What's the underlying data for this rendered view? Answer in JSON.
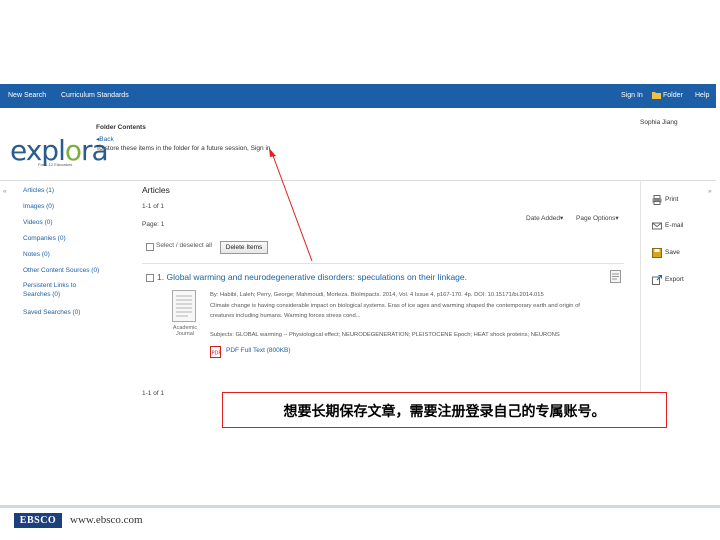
{
  "topbar": {
    "new_search": "New Search",
    "curriculum_standards": "Curriculum Standards",
    "sign_in": "Sign In",
    "folder": "Folder",
    "help": "Help"
  },
  "header": {
    "logo_left": "expl",
    "logo_o": "o",
    "logo_right": "ra",
    "logo_tagline": "For 1-12 Educators",
    "folder_contents": "Folder Contents",
    "back": "Back",
    "store_note": "To store these items in the folder for a future session, Sign in",
    "user_name": "Sophia Jiang"
  },
  "sidebar": {
    "items": [
      {
        "label": "Articles (1)"
      },
      {
        "label": "Images (0)"
      },
      {
        "label": "Videos (0)"
      },
      {
        "label": "Companies (0)"
      },
      {
        "label": "Notes (0)"
      },
      {
        "label": "Other Content Sources (0)"
      },
      {
        "label": "Persistent Links to Searches (0)"
      },
      {
        "label": "Saved Searches (0)"
      }
    ]
  },
  "main": {
    "heading": "Articles",
    "count": "1-1 of 1",
    "page": "Page: 1",
    "date_added": "Date Added",
    "page_options": "Page Options",
    "select_all": "Select / deselect all",
    "delete_items": "Delete Items",
    "result": {
      "number": "1.",
      "title": "Global warming and neurodegenerative disorders: speculations on their linkage.",
      "doc_type": "Academic Journal",
      "authors_line": "By: Habibi, Laleh; Perry, George; Mahmoudi, Morteza. BioImpacts. 2014, Vol. 4 Issue 4, p167-170. 4p. DOI: 10.15171/bi.2014.015",
      "abstract_1": "Climate change is having considerable impact on biological systems. Eras of ice ages and warming shaped the contemporary earth and origin of",
      "abstract_2": "creatures including humans. Warming forces stress cond...",
      "subjects": "Subjects: GLOBAL warming -- Physiological effect; NEURODEGENERATION; PLEISTOCENE Epoch; HEAT shock proteins; NEURONS",
      "pdf": "PDF Full Text (800KB)"
    },
    "count_bottom": "1-1 of 1"
  },
  "tools": {
    "print": "Print",
    "email": "E-mail",
    "save": "Save",
    "export": "Export"
  },
  "callout": {
    "text": "想要长期保存文章，需要注册登录自己的专属账号。"
  },
  "footer": {
    "brand": "EBSCO",
    "url": "www.ebsco.com"
  },
  "colors": {
    "topbar": "#1c5fa6",
    "link": "#1c5fa6",
    "callout_border": "#e02020",
    "logo_blue": "#2c5b8f",
    "logo_green": "#7bb03a"
  }
}
